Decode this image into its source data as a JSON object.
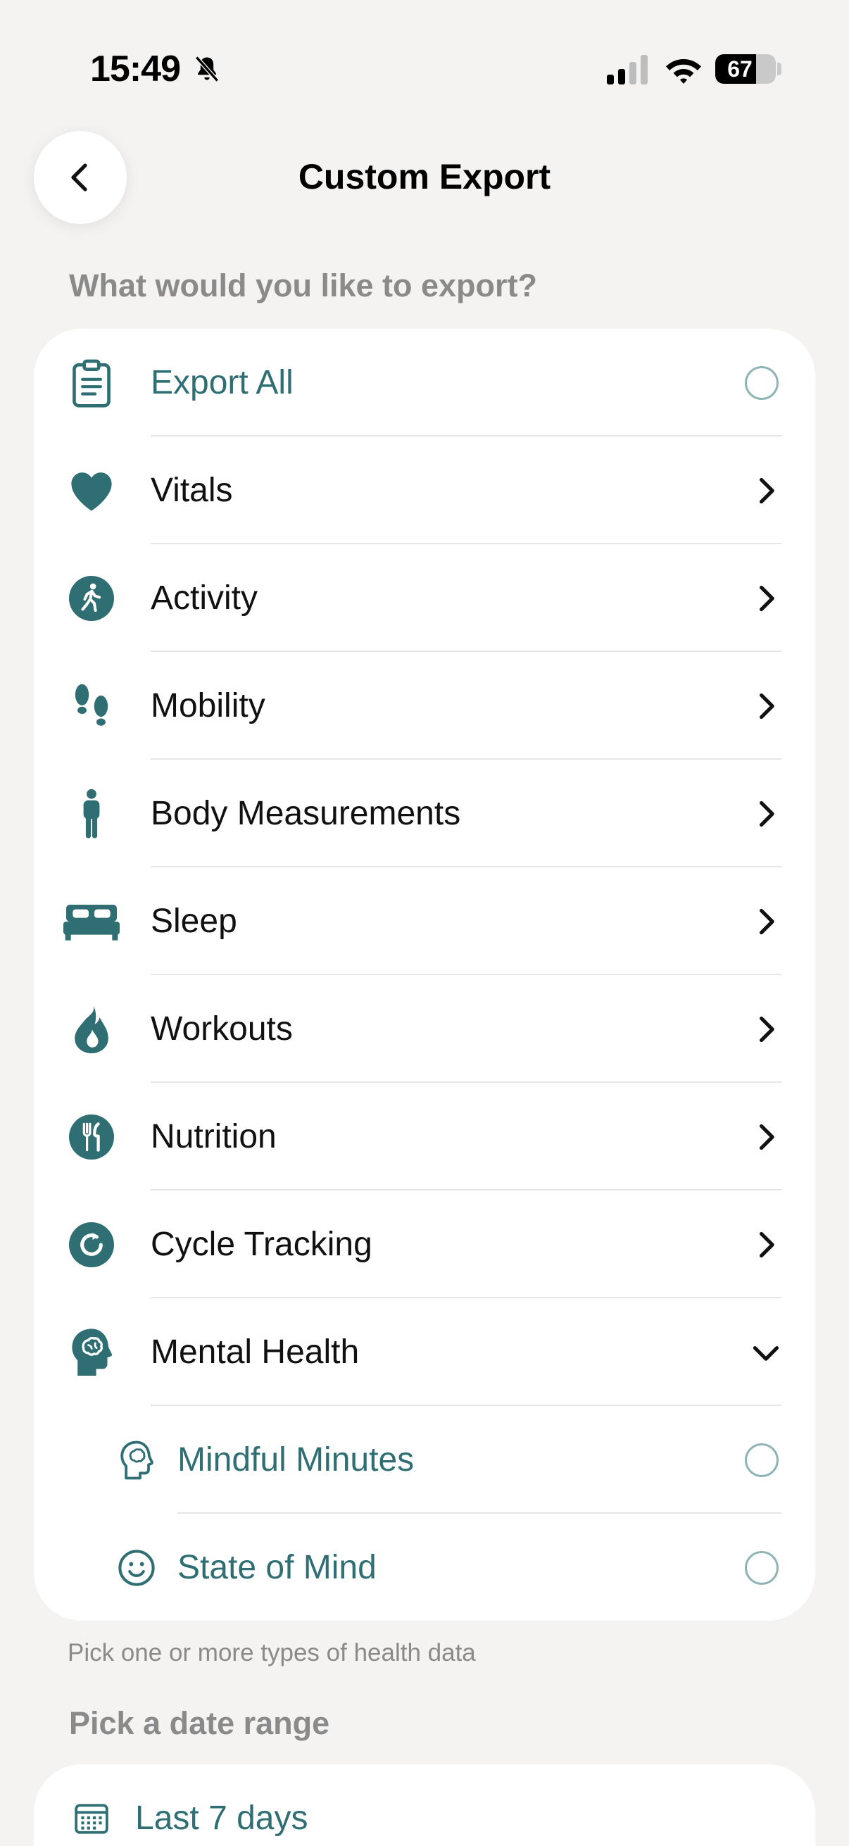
{
  "status": {
    "time": "15:49",
    "battery": "67",
    "battery_level": 0.67
  },
  "header": {
    "title": "Custom Export"
  },
  "export_section": {
    "heading": "What would you like to export?",
    "export_all_label": "Export All",
    "categories": [
      {
        "label": "Vitals",
        "icon": "heart-icon"
      },
      {
        "label": "Activity",
        "icon": "walking-icon"
      },
      {
        "label": "Mobility",
        "icon": "footprints-icon"
      },
      {
        "label": "Body Measurements",
        "icon": "person-icon"
      },
      {
        "label": "Sleep",
        "icon": "bed-icon"
      },
      {
        "label": "Workouts",
        "icon": "flame-icon"
      },
      {
        "label": "Nutrition",
        "icon": "fork-knife-icon"
      },
      {
        "label": "Cycle Tracking",
        "icon": "cycle-icon"
      },
      {
        "label": "Mental Health",
        "icon": "brain-head-icon"
      }
    ],
    "mental_health_items": [
      {
        "label": "Mindful Minutes",
        "icon": "mindful-head-icon"
      },
      {
        "label": "State of Mind",
        "icon": "smiley-icon"
      }
    ],
    "footnote": "Pick one or more types of health data"
  },
  "date_section": {
    "heading": "Pick a date range",
    "selected_label": "Last 7 days"
  },
  "colors": {
    "accent": "#2f6f74",
    "background": "#f4f3f1",
    "card": "#ffffff"
  }
}
